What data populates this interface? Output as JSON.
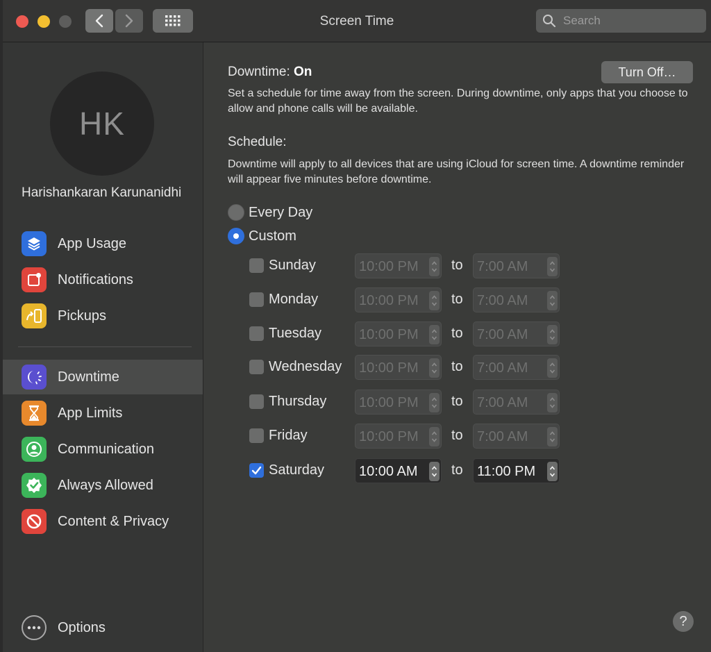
{
  "window": {
    "title": "Screen Time",
    "search_placeholder": "Search"
  },
  "sidebar": {
    "avatar_initials": "HK",
    "user_name": "Harishankaran Karunanidhi",
    "items": [
      {
        "label": "App Usage",
        "icon": "layers-icon",
        "color": "#2f6fdc"
      },
      {
        "label": "Notifications",
        "icon": "notification-icon",
        "color": "#e0453c"
      },
      {
        "label": "Pickups",
        "icon": "pickup-icon",
        "color": "#e8b62c"
      },
      {
        "label": "Downtime",
        "icon": "downtime-icon",
        "color": "#5a4fcf",
        "selected": true
      },
      {
        "label": "App Limits",
        "icon": "hourglass-icon",
        "color": "#e8892c"
      },
      {
        "label": "Communication",
        "icon": "person-icon",
        "color": "#3cb55a"
      },
      {
        "label": "Always Allowed",
        "icon": "checkmark-badge-icon",
        "color": "#3cb55a"
      },
      {
        "label": "Content & Privacy",
        "icon": "restriction-icon",
        "color": "#e0453c"
      }
    ],
    "options_label": "Options"
  },
  "main": {
    "heading_prefix": "Downtime:",
    "heading_state": "On",
    "turn_off_label": "Turn Off…",
    "description": "Set a schedule for time away from the screen. During downtime, only apps that you choose to allow and phone calls will be available.",
    "schedule_label": "Schedule:",
    "schedule_description": "Downtime will apply to all devices that are using iCloud for screen time. A downtime reminder will appear five minutes before downtime.",
    "options": [
      {
        "label": "Every Day",
        "selected": false
      },
      {
        "label": "Custom",
        "selected": true
      }
    ],
    "to_label": "to",
    "days": [
      {
        "day": "Sunday",
        "checked": false,
        "from": "10:00 PM",
        "to": "7:00 AM"
      },
      {
        "day": "Monday",
        "checked": false,
        "from": "10:00 PM",
        "to": "7:00 AM"
      },
      {
        "day": "Tuesday",
        "checked": false,
        "from": "10:00 PM",
        "to": "7:00 AM"
      },
      {
        "day": "Wednesday",
        "checked": false,
        "from": "10:00 PM",
        "to": "7:00 AM"
      },
      {
        "day": "Thursday",
        "checked": false,
        "from": "10:00 PM",
        "to": "7:00 AM"
      },
      {
        "day": "Friday",
        "checked": false,
        "from": "10:00 PM",
        "to": "7:00 AM"
      },
      {
        "day": "Saturday",
        "checked": true,
        "from": "10:00 AM",
        "to": "11:00 PM"
      }
    ],
    "help_label": "?"
  }
}
